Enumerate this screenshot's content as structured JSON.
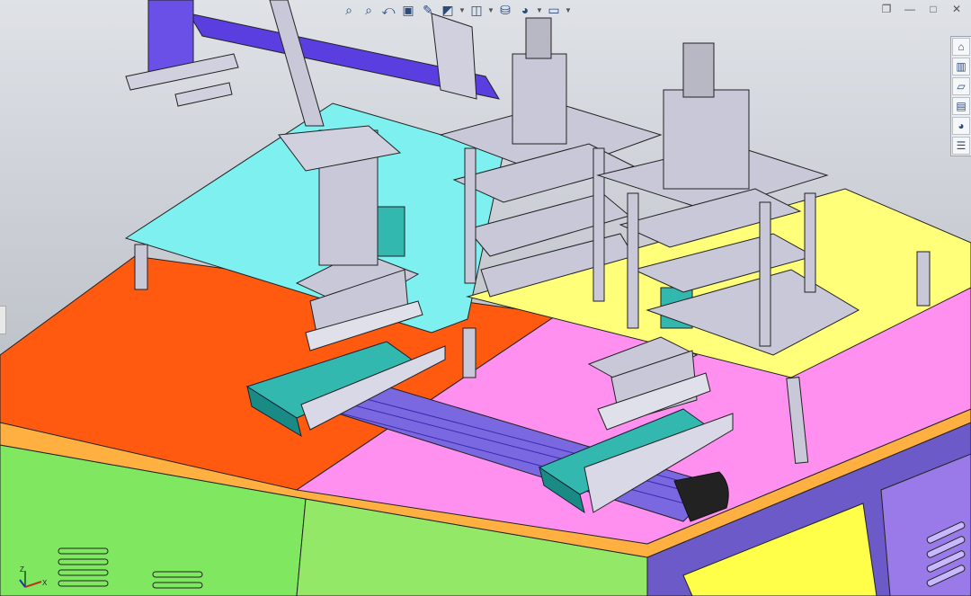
{
  "window": {
    "restore_label": "❐",
    "minimize_label": "—",
    "maximize_label": "□",
    "close_label": "✕"
  },
  "heads_up_toolbar": [
    {
      "icon": "zoom-to-fit-icon",
      "glyph": "⌕"
    },
    {
      "icon": "zoom-to-area-icon",
      "glyph": "⌕"
    },
    {
      "icon": "previous-view-icon",
      "glyph": "⤺"
    },
    {
      "icon": "section-view-icon",
      "glyph": "▣"
    },
    {
      "icon": "view-orientation-icon",
      "glyph": "✎"
    },
    {
      "icon": "display-style-icon",
      "glyph": "◩"
    },
    {
      "icon": "hide-show-items-icon",
      "glyph": "◫"
    },
    {
      "icon": "edit-appearance-icon",
      "glyph": "⛁"
    },
    {
      "icon": "apply-scene-icon",
      "glyph": "◕"
    },
    {
      "icon": "view-settings-icon",
      "glyph": "▭"
    }
  ],
  "task_pane": [
    {
      "icon": "home-icon",
      "glyph": "⌂"
    },
    {
      "icon": "design-library-icon",
      "glyph": "▥"
    },
    {
      "icon": "file-explorer-icon",
      "glyph": "▱"
    },
    {
      "icon": "view-palette-icon",
      "glyph": "▤"
    },
    {
      "icon": "appearances-icon",
      "glyph": "◕"
    },
    {
      "icon": "custom-properties-icon",
      "glyph": "☰"
    }
  ],
  "triad": {
    "z_label": "Z",
    "x_label": "X"
  },
  "colors": {
    "viewport_bg": "#c9cdd4",
    "table_orange": "#ff5a10",
    "table_pink": "#ff90f0",
    "plate_cyan": "#7ff0f0",
    "plate_yellow": "#ffff7a",
    "cabinet_green": "#7fe860",
    "gantry_blue": "#5a3ee0",
    "linear_axis_teal": "#33b8b0",
    "fixture_gray": "#c8c8d8"
  }
}
